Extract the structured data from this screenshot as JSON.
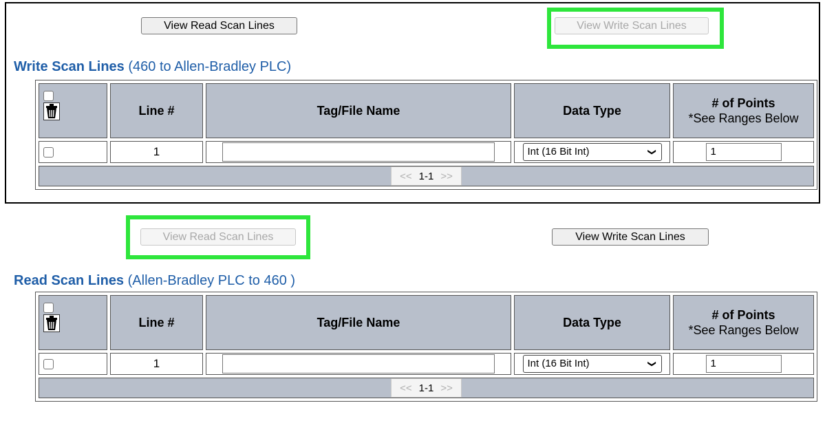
{
  "colors": {
    "title_blue": "#1f5ea8",
    "header_gray": "#b8bfcb",
    "highlight_green": "#2ee63c"
  },
  "write_panel": {
    "buttons": {
      "view_read": "View Read Scan Lines",
      "view_write": "View Write Scan Lines",
      "view_write_disabled": true
    },
    "title_bold": "Write Scan Lines",
    "title_rest": "(460 to Allen-Bradley PLC)",
    "headers": {
      "line": "Line #",
      "tag": "Tag/File Name",
      "type": "Data Type",
      "points": "# of Points",
      "points_note": "*See Ranges Below"
    },
    "rows": [
      {
        "line": "1",
        "tag": "",
        "type": "Int (16 Bit Int)",
        "points": "1"
      }
    ],
    "pager": {
      "prev": "<<",
      "range": "1-1",
      "next": ">>"
    }
  },
  "read_panel": {
    "buttons": {
      "view_read": "View Read Scan Lines",
      "view_write": "View Write Scan Lines",
      "view_read_disabled": true
    },
    "title_bold": "Read Scan Lines",
    "title_rest": "(Allen-Bradley PLC to 460 )",
    "headers": {
      "line": "Line #",
      "tag": "Tag/File Name",
      "type": "Data Type",
      "points": "# of Points",
      "points_note": "*See Ranges Below"
    },
    "rows": [
      {
        "line": "1",
        "tag": "",
        "type": "Int (16 Bit Int)",
        "points": "1"
      }
    ],
    "pager": {
      "prev": "<<",
      "range": "1-1",
      "next": ">>"
    }
  }
}
